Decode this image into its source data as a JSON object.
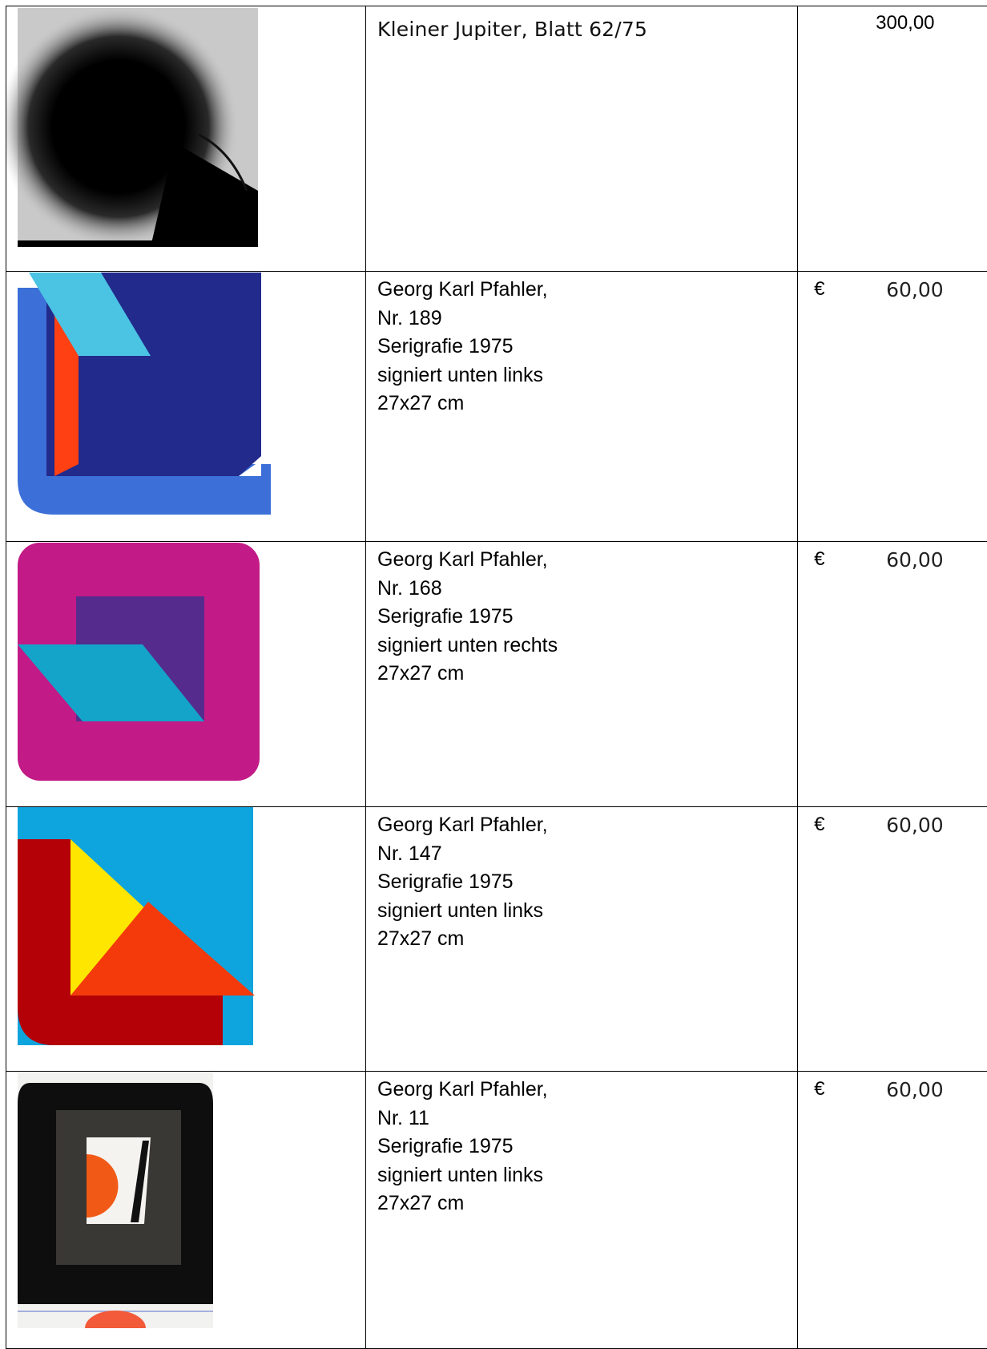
{
  "rows": [
    {
      "image_name": "spray-black-circle-artwork",
      "description": "Kleiner Jupiter, Blatt 62/75",
      "currency": "",
      "price": "300,00"
    },
    {
      "image_name": "pfahler-nr-189-artwork",
      "description": "Georg Karl Pfahler,\nNr. 189\nSerigrafie 1975\nsigniert unten links\n27x27 cm",
      "currency": "€",
      "price": "60,00"
    },
    {
      "image_name": "pfahler-nr-168-artwork",
      "description": "Georg Karl Pfahler,\nNr. 168\nSerigrafie 1975\nsigniert unten rechts\n27x27 cm",
      "currency": "€",
      "price": "60,00"
    },
    {
      "image_name": "pfahler-nr-147-artwork",
      "description": "Georg Karl Pfahler,\nNr. 147\nSerigrafie 1975\nsigniert unten links\n27x27 cm",
      "currency": "€",
      "price": "60,00"
    },
    {
      "image_name": "pfahler-nr-11-artwork",
      "description": "Georg Karl Pfahler,\nNr. 11\nSerigrafie 1975\nsigniert unten links\n27x27 cm",
      "currency": "€",
      "price": "60,00"
    }
  ]
}
